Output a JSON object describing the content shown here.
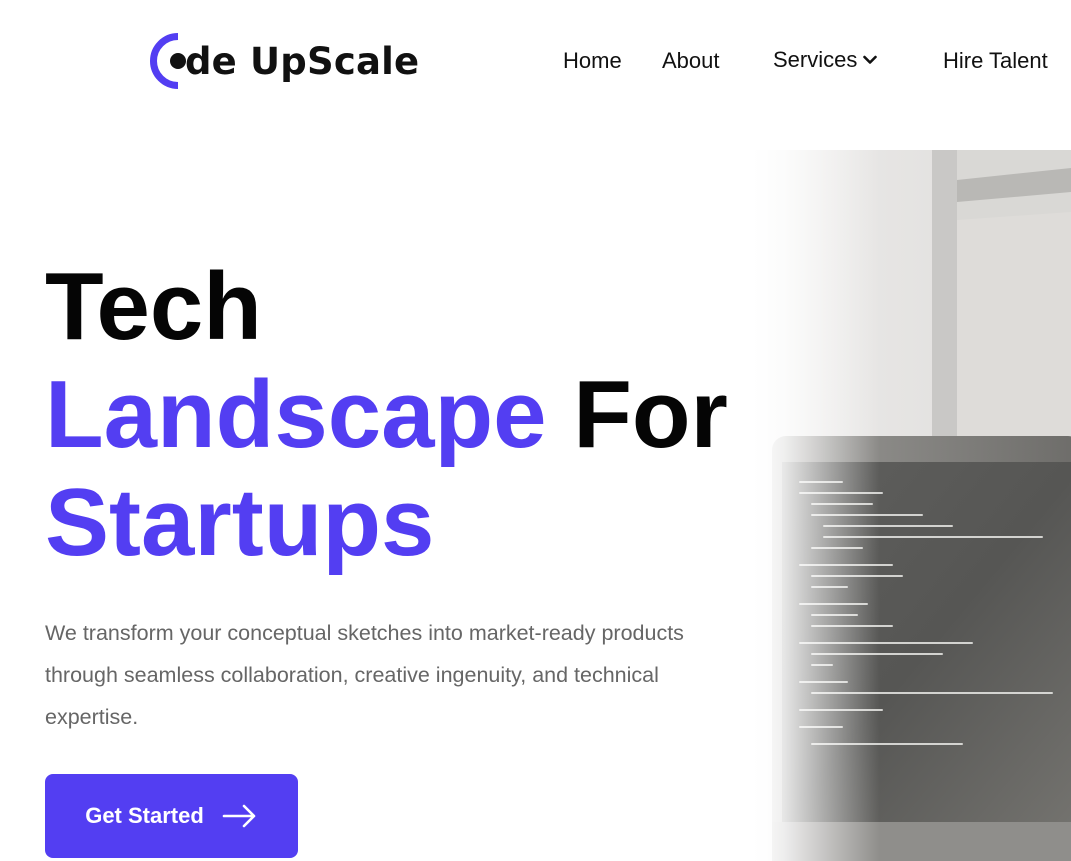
{
  "brand": {
    "logo_text": "de UpScale",
    "logo_icon": "code-c-icon",
    "accent_color": "#533ef2"
  },
  "nav": {
    "items": [
      {
        "label": "Home"
      },
      {
        "label": "About"
      },
      {
        "label": "Services",
        "has_dropdown": true
      },
      {
        "label": "Hire Talent"
      }
    ]
  },
  "hero": {
    "headline": {
      "line1": "Tech",
      "line2_accent": "Landscape",
      "line2_plain": "For",
      "line3_accent": "Startups"
    },
    "description": "We transform your conceptual sketches into market-ready products through seamless collaboration, creative ingenuity, and technical expertise.",
    "cta_label": "Get Started",
    "cta_icon": "arrow-right-icon",
    "image_alt": "laptop-with-code-photo"
  }
}
